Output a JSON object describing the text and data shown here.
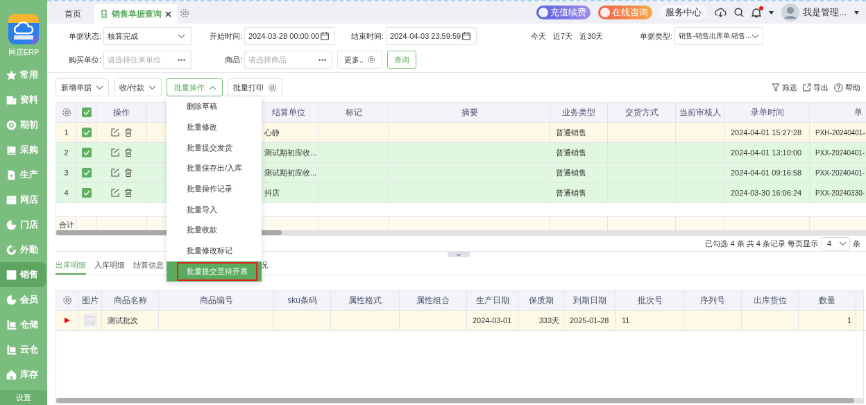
{
  "sidebar": {
    "app_name": "网店ERP",
    "items": [
      {
        "label": "常用",
        "selected": false
      },
      {
        "label": "资料",
        "selected": false
      },
      {
        "label": "期初",
        "selected": false
      },
      {
        "label": "采购",
        "selected": false
      },
      {
        "label": "生产",
        "selected": false
      },
      {
        "label": "网店",
        "selected": false
      },
      {
        "label": "门店",
        "selected": false
      },
      {
        "label": "外勤",
        "selected": false
      },
      {
        "label": "销售",
        "selected": true
      },
      {
        "label": "会员",
        "selected": false
      },
      {
        "label": "仓储",
        "selected": false
      },
      {
        "label": "云仓",
        "selected": false
      },
      {
        "label": "库存",
        "selected": false
      }
    ],
    "footer": "设置"
  },
  "top_bar": {
    "tabs": [
      {
        "label": "首页",
        "selected": false,
        "closable": false
      },
      {
        "label": "销售单据查询",
        "selected": true,
        "closable": true
      }
    ],
    "actions": [
      {
        "kind": "recharge",
        "label": "充值续费"
      },
      {
        "kind": "consult",
        "label": "在线咨询"
      },
      {
        "kind": "plain",
        "label": "服务中心"
      }
    ],
    "notification_dot": true,
    "user_name": "我是管理..."
  },
  "filters": {
    "row_1": [
      {
        "kind": "select",
        "label": "单据状态:",
        "value": "核算完成"
      },
      {
        "kind": "date",
        "label": "开始时间:",
        "value": "2024-03-28 00:00:00"
      },
      {
        "kind": "date",
        "label": "结束时间:",
        "value": "2024-04-03 23:59:59"
      }
    ],
    "quick_ranges": [
      "今天",
      "近7天",
      "近30天"
    ],
    "doc_type": {
      "label": "单据类型:",
      "value": "销售-销售出库单,销售..."
    },
    "row_2": [
      {
        "kind": "picker",
        "label": "购买单位:",
        "placeholder": "请选择往来单位"
      },
      {
        "kind": "picker",
        "label": "商品:",
        "placeholder": "请选择商品"
      }
    ],
    "more_button": "更多..",
    "search_button": "查询"
  },
  "toolbar": {
    "buttons": [
      {
        "kind": "dropdown",
        "label": "新增单据",
        "expanded": false
      },
      {
        "kind": "dropdown",
        "label": "收/付款",
        "expanded": false
      },
      {
        "kind": "dropdown",
        "label": "批量操作",
        "expanded": true
      },
      {
        "kind": "settings",
        "label": "批量打印",
        "expanded": false
      }
    ],
    "tools": [
      {
        "kind": "filter",
        "label": "筛选"
      },
      {
        "kind": "export",
        "label": "导出"
      },
      {
        "kind": "help",
        "label": "帮助"
      }
    ]
  },
  "batch_menu": {
    "items": [
      {
        "label": "删除草稿",
        "selected": false,
        "outlined": false
      },
      {
        "label": "批量修改",
        "selected": false,
        "outlined": false
      },
      {
        "label": "批量提交发货",
        "selected": false,
        "outlined": false
      },
      {
        "label": "批量保存出/入库",
        "selected": false,
        "outlined": false
      },
      {
        "label": "批量操作记录",
        "selected": false,
        "outlined": false
      },
      {
        "label": "批量导入",
        "selected": false,
        "outlined": false
      },
      {
        "label": "批量收款",
        "selected": false,
        "outlined": false
      },
      {
        "label": "批量修改标记",
        "selected": false,
        "outlined": false
      },
      {
        "label": "批量提交至待开票",
        "selected": true,
        "outlined": true
      }
    ]
  },
  "orders_table": {
    "columns": [
      {
        "kind": "settings"
      },
      {
        "kind": "select_all",
        "checked": true
      },
      {
        "kind": "text",
        "label": "操作"
      },
      {
        "kind": "covered"
      },
      {
        "kind": "text",
        "label": "结算单位"
      },
      {
        "kind": "text",
        "label": "标记"
      },
      {
        "kind": "text",
        "label": "摘要"
      },
      {
        "kind": "text",
        "label": "业务类型"
      },
      {
        "kind": "text",
        "label": "交货方式"
      },
      {
        "kind": "text",
        "label": "当前审核人"
      },
      {
        "kind": "text",
        "label": "录单时间"
      },
      {
        "kind": "text",
        "label": "单"
      }
    ],
    "rows": [
      {
        "index": "1",
        "checked": true,
        "current": true,
        "settlement": "心静",
        "business_type": "普通销售",
        "entry_time": "2024-04-01 15:27:28",
        "doc_no": "PXH-20240401-"
      },
      {
        "index": "2",
        "checked": true,
        "current": false,
        "settlement": "测试期初应收...",
        "business_type": "普通销售",
        "entry_time": "2024-04-01 13:10:00",
        "doc_no": "PXX-20240401-"
      },
      {
        "index": "3",
        "checked": true,
        "current": false,
        "settlement": "测试期初应收...",
        "business_type": "普通销售",
        "entry_time": "2024-04-01 09:16:58",
        "doc_no": "PXX-20240401-"
      },
      {
        "index": "4",
        "checked": true,
        "current": false,
        "settlement": "抖店",
        "business_type": "普通销售",
        "entry_time": "2024-03-30 16:06:24",
        "doc_no": "PXX-20240330-"
      }
    ],
    "total_label": "合计"
  },
  "pagination": {
    "summary": "已勾选 4 条 共 4 条记录 每页显示",
    "page_size": "4",
    "unit": "条"
  },
  "detail_tabs": [
    {
      "label": "出库明细",
      "selected": true
    },
    {
      "label": "入库明细",
      "selected": false
    },
    {
      "label": "结算信息",
      "selected": false
    },
    {
      "label": "况",
      "selected": false
    }
  ],
  "detail_table": {
    "columns": [
      {
        "kind": "settings"
      },
      {
        "kind": "text",
        "label": "图片"
      },
      {
        "kind": "text",
        "label": "商品名称"
      },
      {
        "kind": "text",
        "label": "商品编号"
      },
      {
        "kind": "text",
        "label": "sku条码"
      },
      {
        "kind": "text",
        "label": "属性格式"
      },
      {
        "kind": "text",
        "label": "属性组合"
      },
      {
        "kind": "text",
        "label": "生产日期"
      },
      {
        "kind": "text",
        "label": "保质期"
      },
      {
        "kind": "text",
        "label": "到期日期"
      },
      {
        "kind": "text",
        "label": "批次号"
      },
      {
        "kind": "text",
        "label": "序列号"
      },
      {
        "kind": "text",
        "label": "出库货位"
      },
      {
        "kind": "text",
        "label": "数量"
      }
    ],
    "rows": [
      {
        "current": true,
        "name": "测试批次",
        "production_date": "2024-03-01",
        "shelf_life": "333天",
        "expiry_date": "2025-01-28",
        "batch_no": "11",
        "quantity": "1"
      }
    ]
  }
}
